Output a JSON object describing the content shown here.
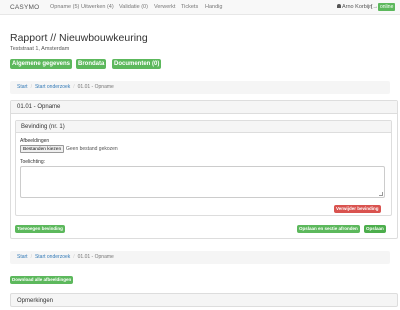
{
  "navbar": {
    "brand": "CASYMO",
    "items": [
      {
        "label": "Opname (5)"
      },
      {
        "label": "Uitwerken (4)"
      },
      {
        "label": "Validatie (0)"
      },
      {
        "label": "Verwerkt"
      },
      {
        "label": "Tickets"
      },
      {
        "label": "Handig"
      }
    ],
    "user": "Arno Korbijn",
    "status": "online"
  },
  "header": {
    "title": "Rapport // Nieuwbouwkeuring",
    "address": "Teststraat 1, Amsterdam"
  },
  "tabs": {
    "general": "Algemene gegevens",
    "brondata": "Brondata",
    "documents": "Documenten (0)"
  },
  "breadcrumb_top": {
    "start": "Start",
    "start_onderzoek": "Start onderzoek",
    "current": "01.01 - Opname"
  },
  "section": {
    "title": "01.01 - Opname",
    "finding": {
      "title": "Bevinding (nr. 1)",
      "images_label": "Afbeeldingen",
      "file_button": "Bestanden kiezen",
      "file_status": "Geen bestand gekozen",
      "explanation_label": "Toelichting:",
      "explanation_value": "",
      "delete_button": "Verwijder bevinding"
    },
    "add_finding_button": "Toevoegen bevinding",
    "save_close_button": "Opslaan en sectie afronden",
    "save_button": "Opslaan"
  },
  "breadcrumb_bottom": {
    "start": "Start",
    "start_onderzoek": "Start onderzoek",
    "current": "01.01 - Opname"
  },
  "download_button": "Download alle afbeeldingen",
  "comments": {
    "title": "Opmerkingen"
  },
  "colors": {
    "success": "#5cb85c",
    "danger": "#d9534f",
    "link": "#337ab7"
  }
}
